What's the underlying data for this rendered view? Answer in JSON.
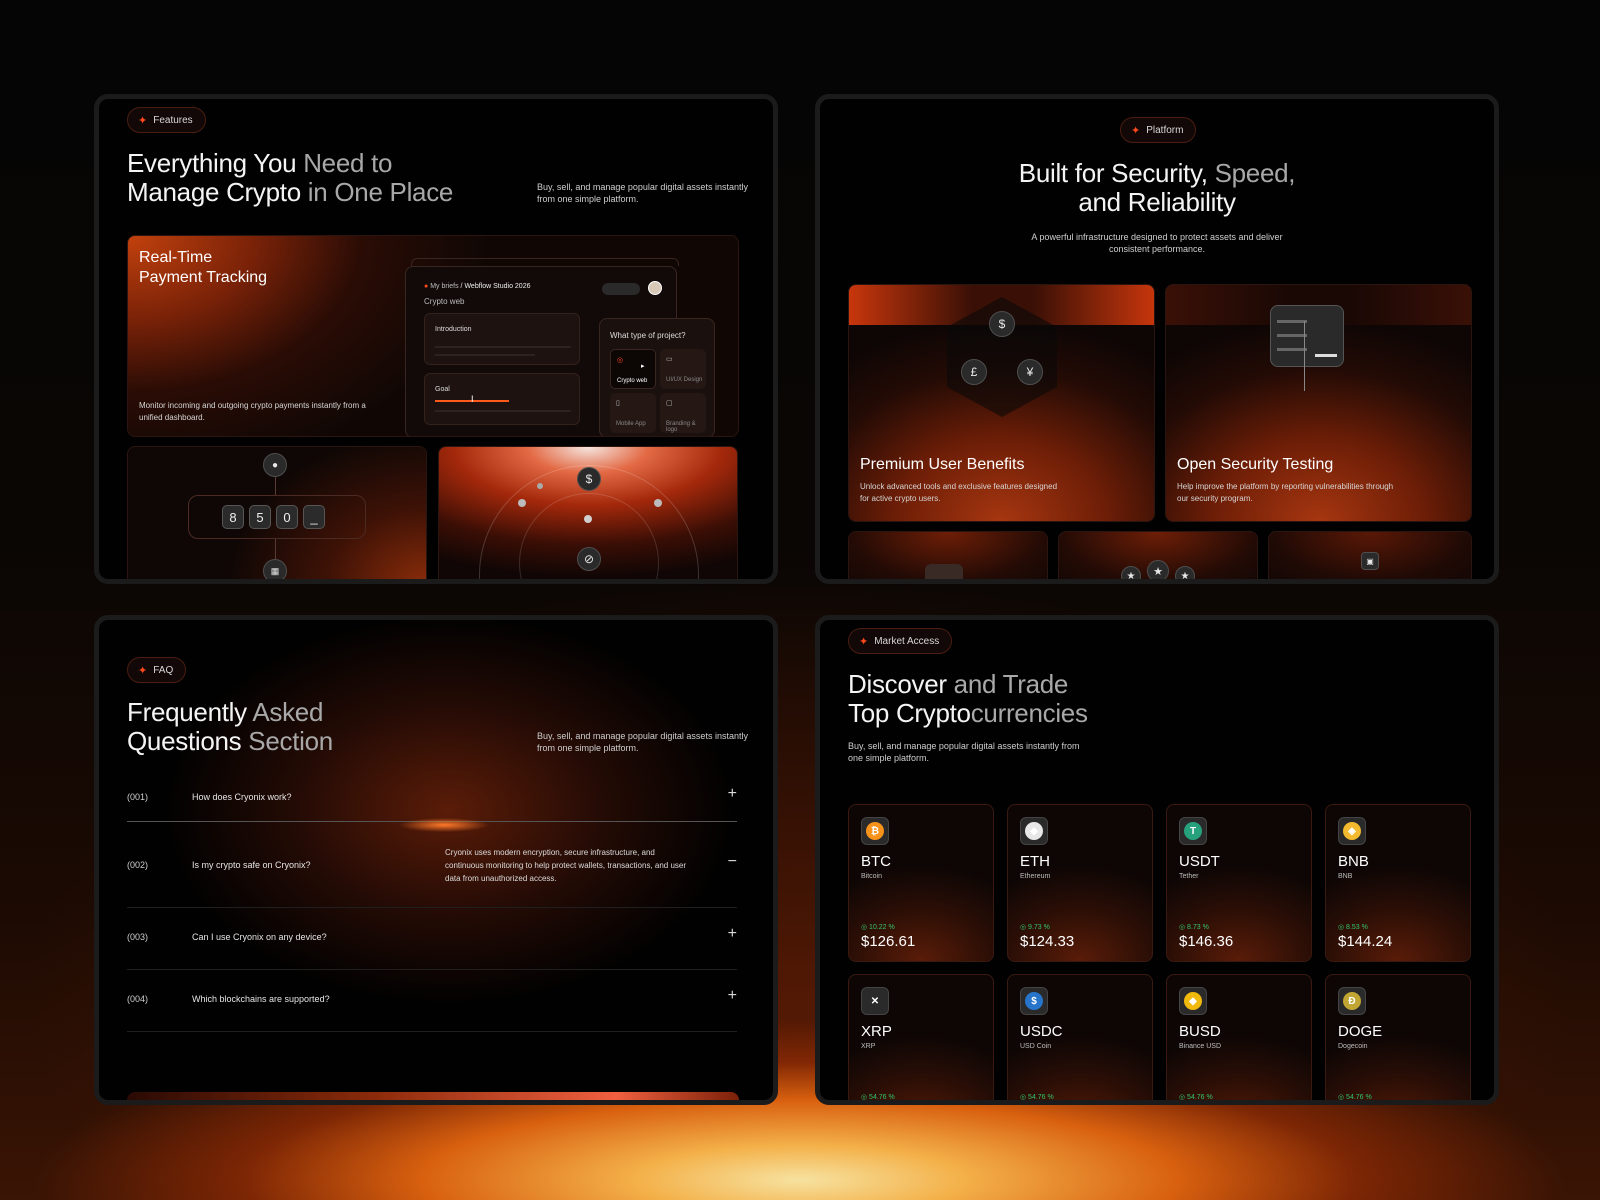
{
  "colors": {
    "accent": "#ff4a1c",
    "bg": "#010101",
    "positive": "#34c46a"
  },
  "features": {
    "badge": "Features",
    "title_a": "Everything You ",
    "title_b": "Need to",
    "title_c": "Manage Crypto ",
    "title_d": "in One Place",
    "sub_1": "Buy, sell, and manage popular digital assets instantly",
    "sub_2": "from one simple platform.",
    "card_title_1": "Real-Time",
    "card_title_2": "Payment Tracking",
    "card_desc_1": "Monitor incoming and outgoing crypto payments instantly from a",
    "card_desc_2": "unified dashboard.",
    "mock": {
      "crumb_1": "My briefs",
      "sep": "/",
      "crumb_2": "Webflow Studio 2026",
      "subtitle": "Crypto web",
      "intro": "Introduction",
      "goal": "Goal",
      "question": "What type of project?",
      "opt_1": "Crypto web",
      "opt_2": "UI/UX Design",
      "opt_3": "Mobile App",
      "opt_4": "Branding & logo"
    },
    "keys": [
      "8",
      "5",
      "0",
      "_"
    ],
    "dollar": "$",
    "link_icon": "link-icon",
    "user_icon": "user-icon"
  },
  "platform": {
    "badge": "Platform",
    "title_a": "Built for Security, ",
    "title_b": "Speed,",
    "title_c": "and Reliability",
    "sub_1": "A powerful infrastructure designed to protect assets and deliver",
    "sub_2": "consistent performance.",
    "card_1": {
      "title": "Premium User Benefits",
      "desc_1": "Unlock advanced tools and exclusive features designed",
      "desc_2": "for active crypto users.",
      "c1": "$",
      "c2": "£",
      "c3": "¥"
    },
    "card_2": {
      "title": "Open Security Testing",
      "desc_1": "Help improve the platform by reporting vulnerabilities through",
      "desc_2": "our security program."
    }
  },
  "faq": {
    "badge": "FAQ",
    "title_a": "Frequently ",
    "title_b": "Asked",
    "title_c": "Questions ",
    "title_d": "Section",
    "sub_1": "Buy, sell, and manage popular digital assets instantly",
    "sub_2": "from one simple platform.",
    "items": [
      {
        "num": "(001)",
        "q": "How does Cryonix work?",
        "icon": "+"
      },
      {
        "num": "(002)",
        "q": "Is my crypto safe on Cryonix?",
        "icon": "−",
        "a_1": "Cryonix uses modern encryption, secure infrastructure, and",
        "a_2": "continuous monitoring to help protect wallets, transactions, and user",
        "a_3": "data from unauthorized access."
      },
      {
        "num": "(003)",
        "q": "Can I use Cryonix on any device?",
        "icon": "+"
      },
      {
        "num": "(004)",
        "q": "Which blockchains are supported?",
        "icon": "+"
      }
    ]
  },
  "market": {
    "badge": "Market Access",
    "title_a": "Discover ",
    "title_b": "and Trade",
    "title_c": "Top Crypto",
    "title_d": "currencies",
    "sub_1": "Buy, sell, and manage popular digital assets instantly from",
    "sub_2": "one simple platform.",
    "coins": [
      {
        "sym": "BTC",
        "name": "Bitcoin",
        "chg": "◎ 10.22 %",
        "price": "$126.61",
        "color": "#f7931a",
        "glyph": "₿"
      },
      {
        "sym": "ETH",
        "name": "Ethereum",
        "chg": "◎ 9.73 %",
        "price": "$124.33",
        "color": "#e8e8e8",
        "glyph": "◆"
      },
      {
        "sym": "USDT",
        "name": "Tether",
        "chg": "◎ 8.73 %",
        "price": "$146.36",
        "color": "#26a17b",
        "glyph": "T"
      },
      {
        "sym": "BNB",
        "name": "BNB",
        "chg": "◎ 8.53 %",
        "price": "$144.24",
        "color": "#f3ba2f",
        "glyph": "◈"
      },
      {
        "sym": "XRP",
        "name": "XRP",
        "chg": "◎ 54.76 %",
        "price": "",
        "color": "#2a2a2a",
        "glyph": "✕"
      },
      {
        "sym": "USDC",
        "name": "USD Coin",
        "chg": "◎ 54.76 %",
        "price": "",
        "color": "#2775ca",
        "glyph": "$"
      },
      {
        "sym": "BUSD",
        "name": "Binance USD",
        "chg": "◎ 54.76 %",
        "price": "",
        "color": "#f0b90b",
        "glyph": "◆"
      },
      {
        "sym": "DOGE",
        "name": "Dogecoin",
        "chg": "◎ 54.76 %",
        "price": "",
        "color": "#c2a633",
        "glyph": "Ð"
      }
    ]
  }
}
